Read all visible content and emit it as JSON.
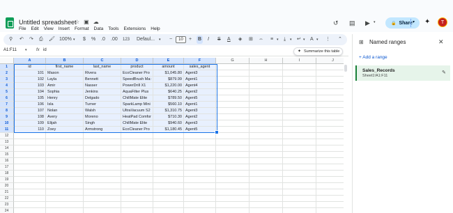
{
  "app": {
    "title": "Untitled spreadsheet",
    "menu": [
      "File",
      "Edit",
      "View",
      "Insert",
      "Format",
      "Data",
      "Tools",
      "Extensions",
      "Help"
    ],
    "share_label": "Share",
    "avatar_initial": "T"
  },
  "toolbar": {
    "zoom": "100%",
    "currency": "$",
    "percent": "%",
    "decimal_decrease": ".0",
    "decimal_increase": ".00",
    "number_format": "123",
    "font": "Defaul...",
    "font_size": "10",
    "bold": "B",
    "italic": "I",
    "strike": "S",
    "text_color": "A"
  },
  "formula_bar": {
    "name_box": "A1:F11",
    "fx": "fx",
    "value": "id"
  },
  "summarize_label": "Summarize this table",
  "grid": {
    "columns": [
      "A",
      "B",
      "C",
      "D",
      "E",
      "F",
      "G",
      "H",
      "I",
      "J"
    ],
    "row_numbers": [
      "1",
      "2",
      "3",
      "4",
      "5",
      "6",
      "7",
      "8",
      "9",
      "10",
      "11",
      "12",
      "13",
      "14",
      "15",
      "16",
      "17",
      "18",
      "19",
      "20",
      "21",
      "22",
      "23",
      "24"
    ],
    "headers": [
      "id",
      "first_name",
      "last_name",
      "product",
      "amount",
      "sales_agent"
    ],
    "rows": [
      [
        "101",
        "Mason",
        "Rivera",
        "EcoCleaner Pro",
        "$1,045.80",
        "Agent3"
      ],
      [
        "102",
        "Layla",
        "Bennett",
        "SpeedBrush Ma:",
        "$879.99",
        "Agent1"
      ],
      [
        "103",
        "Amir",
        "Nasser",
        "PowerDrill X1",
        "$1,220.00",
        "Agent4"
      ],
      [
        "104",
        "Sophia",
        "Jenkins",
        "AquaFilter Plus",
        "$640.25",
        "Agent2"
      ],
      [
        "105",
        "Henry",
        "Delgado",
        "ChillMate Elite",
        "$789.50",
        "Agent5"
      ],
      [
        "106",
        "Isla",
        "Turner",
        "SparkLamp Mini",
        "$560.10",
        "Agent1"
      ],
      [
        "107",
        "Nolan",
        "Walsh",
        "UltraVacuum S2",
        "$1,310.75",
        "Agent3"
      ],
      [
        "108",
        "Avery",
        "Moreno",
        "HeatPad Comfor",
        "$710.30",
        "Agent2"
      ],
      [
        "109",
        "Elijah",
        "Singh",
        "ChillMate Elite",
        "$940.60",
        "Agent3"
      ],
      [
        "110",
        "Zoey",
        "Armstrong",
        "EcoCleaner Pro",
        "$1,180.45",
        "Agent5"
      ]
    ]
  },
  "side_panel": {
    "title": "Named ranges",
    "add_label": "+ Add a range",
    "items": [
      {
        "name": "Sales_Records",
        "range": "Sheet1!A1:F11"
      }
    ]
  }
}
